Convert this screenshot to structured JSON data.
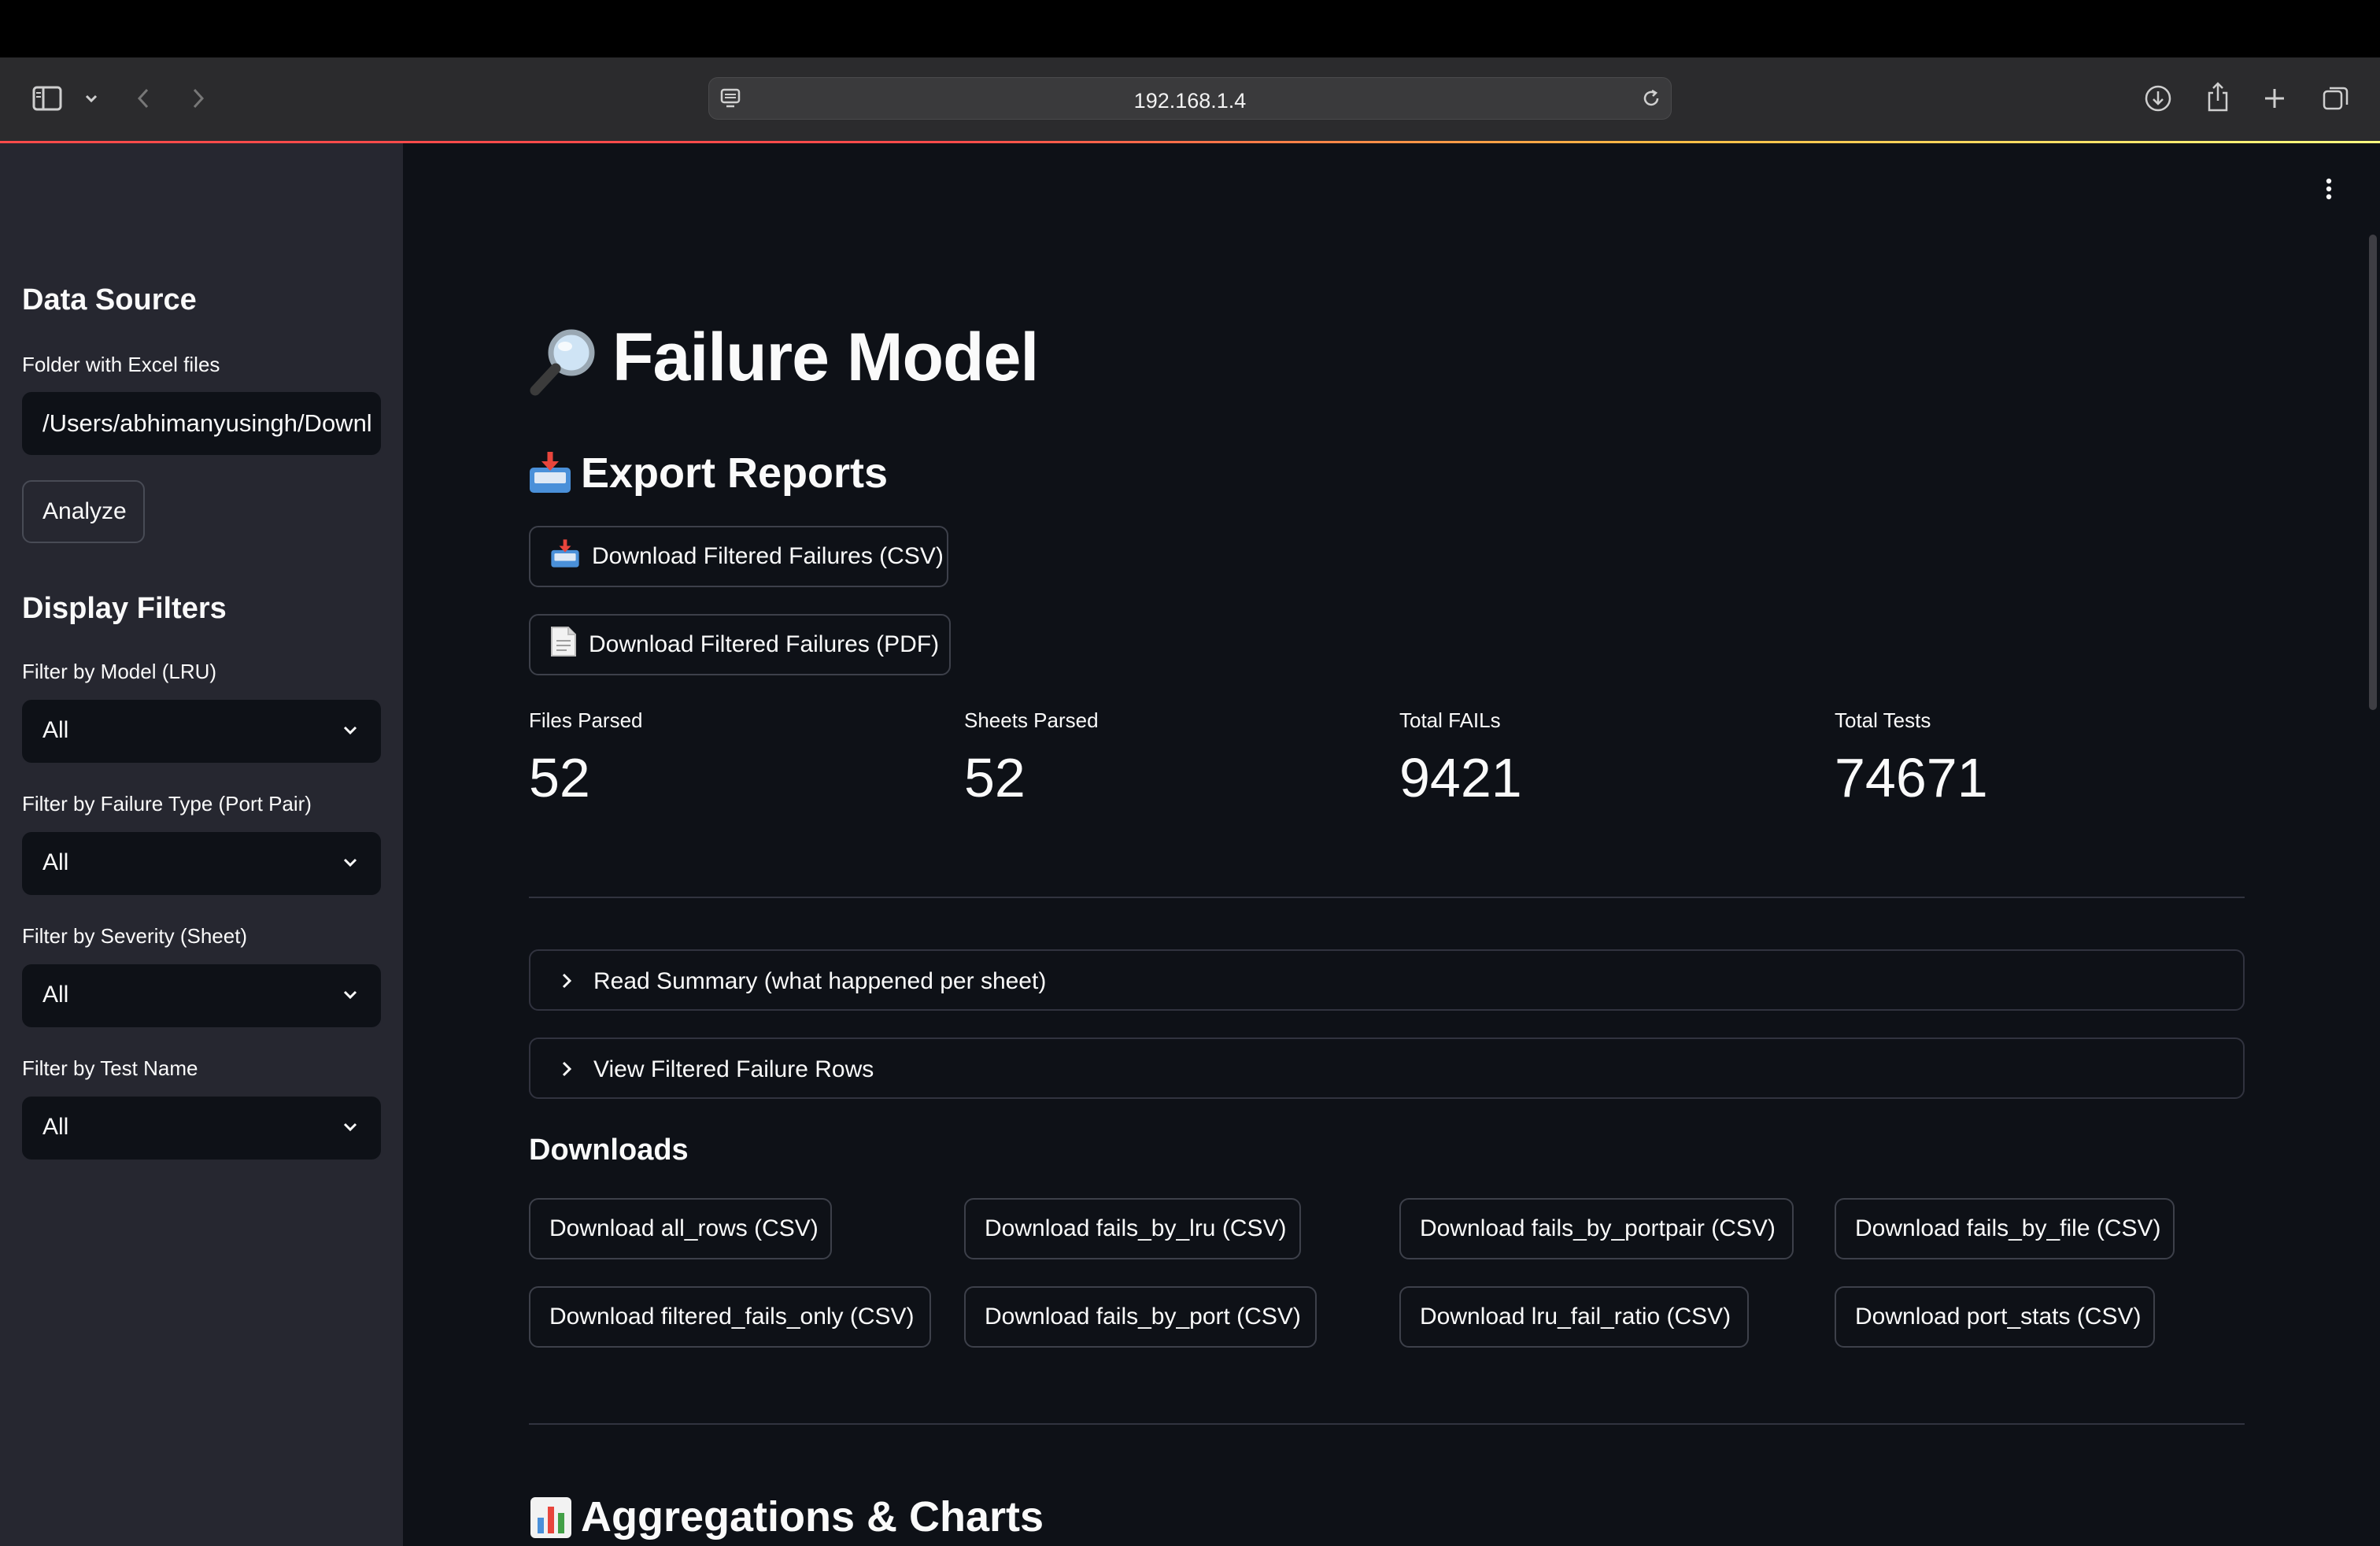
{
  "browser": {
    "url": "192.168.1.4"
  },
  "sidebar": {
    "data_source_heading": "Data Source",
    "folder_label": "Folder with Excel files",
    "folder_value": "/Users/abhimanyusingh/Downl",
    "analyze_button": "Analyze",
    "display_filters_heading": "Display Filters",
    "filters": [
      {
        "label": "Filter by Model (LRU)",
        "value": "All"
      },
      {
        "label": "Filter by Failure Type (Port Pair)",
        "value": "All"
      },
      {
        "label": "Filter by Severity (Sheet)",
        "value": "All"
      },
      {
        "label": "Filter by Test Name",
        "value": "All"
      }
    ]
  },
  "main": {
    "title": "Failure Model",
    "export_heading": "Export Reports",
    "export_buttons": [
      "Download Filtered Failures (CSV)",
      "Download Filtered Failures (PDF)"
    ],
    "metrics": [
      {
        "label": "Files Parsed",
        "value": "52"
      },
      {
        "label": "Sheets Parsed",
        "value": "52"
      },
      {
        "label": "Total FAILs",
        "value": "9421"
      },
      {
        "label": "Total Tests",
        "value": "74671"
      }
    ],
    "expanders": [
      "Read Summary (what happened per sheet)",
      "View Filtered Failure Rows"
    ],
    "downloads_heading": "Downloads",
    "download_buttons": [
      "Download all_rows (CSV)",
      "Download fails_by_lru (CSV)",
      "Download fails_by_portpair (CSV)",
      "Download fails_by_file (CSV)",
      "Download filtered_fails_only (CSV)",
      "Download fails_by_port (CSV)",
      "Download lru_fail_ratio (CSV)",
      "Download port_stats (CSV)"
    ],
    "aggregations_heading": "Aggregations & Charts"
  },
  "icons": {
    "title_emoji": "magnifying-glass-icon",
    "export_emoji": "inbox-tray-icon",
    "pdf_emoji": "page-icon",
    "charts_emoji": "bar-chart-icon"
  },
  "colors": {
    "background": "#0e1117",
    "sidebar": "#262730",
    "border": "#31333f",
    "accent": "#ff4b4b"
  }
}
